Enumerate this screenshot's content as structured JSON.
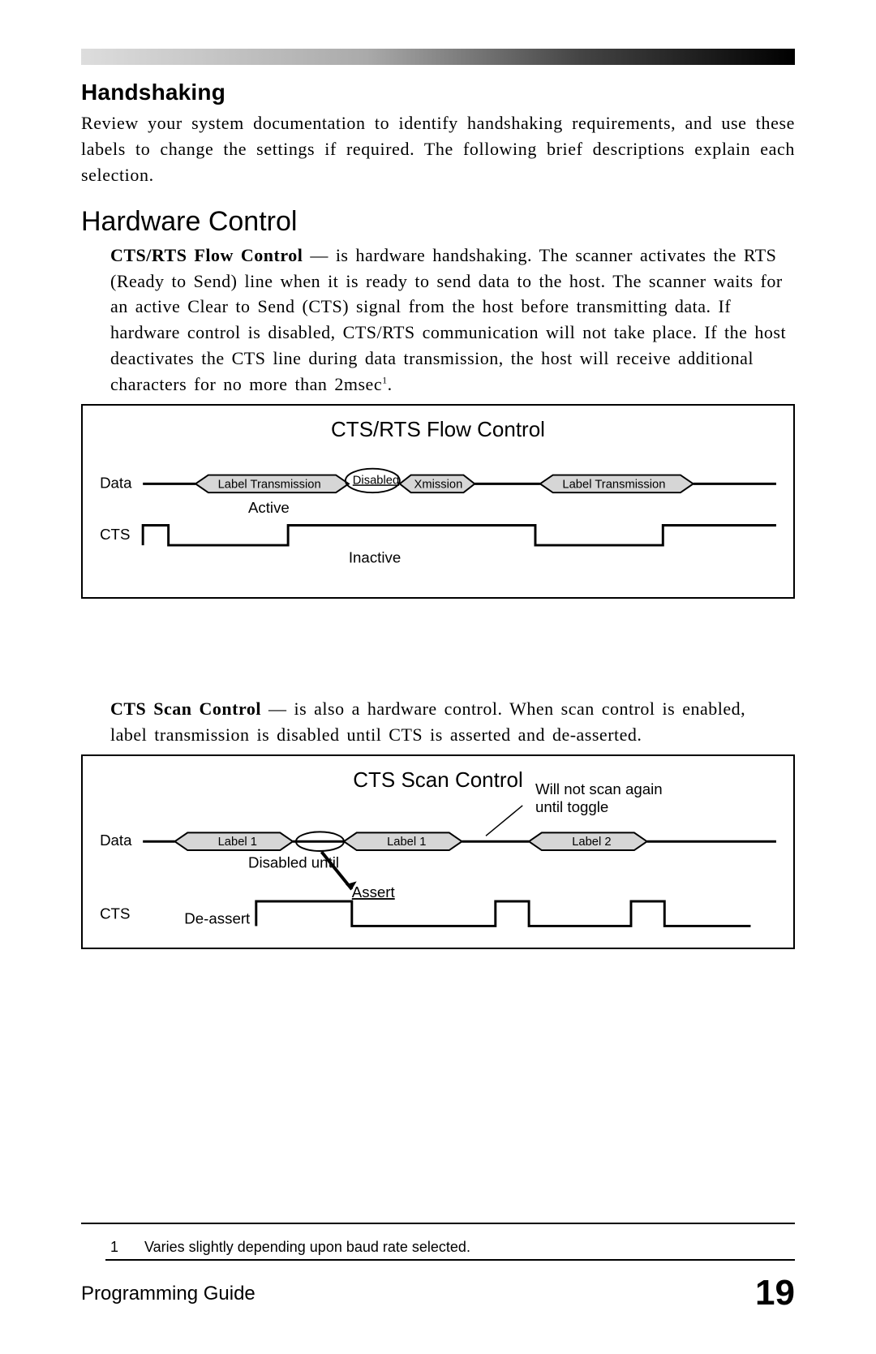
{
  "section_heading": "Handshaking",
  "intro": "Review your system documentation to identify handshaking requirements, and use these labels to change the settings if required.  The following brief descriptions explain each selection.",
  "sub_heading": "Hardware Control",
  "cts_rts": {
    "title": "CTS/RTS Flow Control",
    "dash": "  —  ",
    "text_after": "is hardware handshaking.  The scanner activates the RTS (Ready to Send) line when it is ready to send data to the host.  The scanner waits for an active Clear to Send (CTS) signal from the host before transmitting data.  If hardware control is disabled, CTS/RTS communication will not take place. If the host deactivates the CTS line during data transmission, the host will receive additional characters for no more than 2msec",
    "sup": "1",
    "period": "."
  },
  "diagram1": {
    "title": "CTS/RTS Flow Control",
    "data": "Data",
    "cts": "CTS",
    "label_transmission_1": "Label Transmission",
    "disabled": "Disabled",
    "xmission": "Xmission",
    "label_transmission_2": "Label Transmission",
    "active": "Active",
    "inactive": "Inactive"
  },
  "cts_scan": {
    "title": "CTS Scan Control",
    "dash": "  —  ",
    "text_after": "is also a hardware control.  When scan control is enabled, label transmission is disabled until CTS is asserted and de-asserted."
  },
  "diagram2": {
    "title": "CTS Scan Control",
    "data": "Data",
    "cts": "CTS",
    "label1a": "Label 1",
    "label1b": "Label 1",
    "label2": "Label 2",
    "disabled_until": "Disabled until",
    "assert": "Assert",
    "deassert": "De-assert",
    "note_l1": "Will not scan again",
    "note_l2": "until toggle"
  },
  "footnote": {
    "num": "1",
    "text": "Varies slightly depending upon baud rate selected."
  },
  "footer": {
    "left": "Programming Guide",
    "page": "19"
  }
}
